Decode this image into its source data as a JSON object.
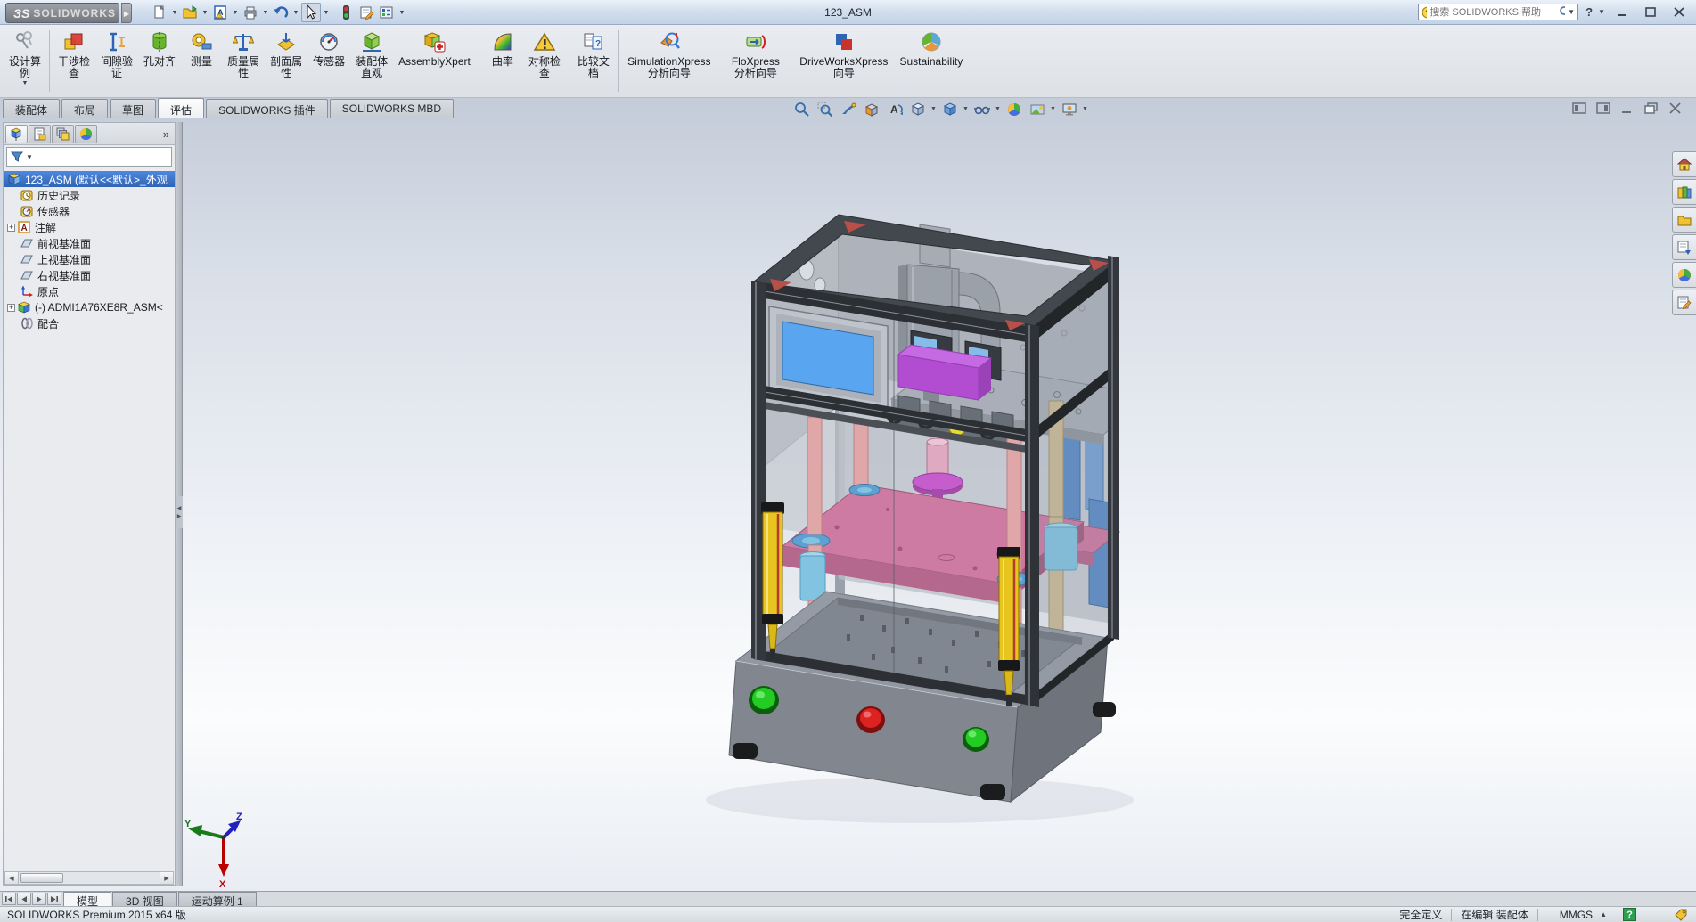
{
  "titlebar": {
    "brand_glyph": "ЗS",
    "brand_name": "SOLIDWORKS",
    "title": "123_ASM",
    "search": {
      "placeholder": "搜索 SOLIDWORKS 帮助"
    }
  },
  "ribbon": {
    "buttons": [
      {
        "id": "design-study",
        "label": "设计算\n例"
      },
      {
        "id": "interference-check",
        "label": "干涉检\n查"
      },
      {
        "id": "clearance-verify",
        "label": "间隙验\n证"
      },
      {
        "id": "hole-alignment",
        "label": "孔对齐"
      },
      {
        "id": "measure",
        "label": "测量"
      },
      {
        "id": "mass-properties",
        "label": "质量属\n性"
      },
      {
        "id": "section-properties",
        "label": "剖面属\n性"
      },
      {
        "id": "sensors",
        "label": "传感器"
      },
      {
        "id": "assembly-visualization",
        "label": "装配体\n直观"
      },
      {
        "id": "assemblyxpert",
        "label": "AssemblyXpert"
      },
      {
        "id": "curvature",
        "label": "曲率"
      },
      {
        "id": "symmetry-check",
        "label": "对称检\n查"
      },
      {
        "id": "compare-documents",
        "label": "比较文\n档"
      },
      {
        "id": "simulationxpress",
        "label": "SimulationXpress\n分析向导"
      },
      {
        "id": "floxpress",
        "label": "FloXpress\n分析向导"
      },
      {
        "id": "driveworksxpress",
        "label": "DriveWorksXpress\n向导"
      },
      {
        "id": "sustainability",
        "label": "Sustainability"
      }
    ]
  },
  "command_tabs": [
    {
      "label": "装配体"
    },
    {
      "label": "布局"
    },
    {
      "label": "草图"
    },
    {
      "label": "评估",
      "active": true
    },
    {
      "label": "SOLIDWORKS 插件"
    },
    {
      "label": "SOLIDWORKS MBD"
    }
  ],
  "feature_tree": {
    "root": "123_ASM (默认<<默认>_外观",
    "items": [
      {
        "label": "历史记录"
      },
      {
        "label": "传感器"
      },
      {
        "label": "注解",
        "expandable": true
      },
      {
        "label": "前视基准面"
      },
      {
        "label": "上视基准面"
      },
      {
        "label": "右视基准面"
      },
      {
        "label": "原点"
      },
      {
        "label": "(-) ADMI1A76XE8R_ASM<",
        "expandable": true
      },
      {
        "label": "配合"
      }
    ]
  },
  "triad": {
    "x": "X",
    "y": "Y",
    "z": "Z"
  },
  "bottom_tabs": [
    {
      "label": "模型",
      "active": true
    },
    {
      "label": "3D 视图"
    },
    {
      "label": "运动算例 1"
    }
  ],
  "status_bar": {
    "product": "SOLIDWORKS Premium 2015 x64 版",
    "defined_state": "完全定义",
    "editing_state": "在编辑 装配体",
    "units": "MMGS"
  },
  "icons": {
    "search": "magnifier",
    "help": "question-balloon",
    "rebuild": "traffic-light",
    "filter": "funnel",
    "mates": "paperclips",
    "origin": "axes",
    "plane": "parallelogram"
  },
  "colors": {
    "selection_blue": "#2f64b5",
    "hmi_screen_blue": "#4da3f7",
    "press_plate_pink": "#d4729e",
    "manifold_purple": "#b43cd4",
    "light_curtain_yellow": "#e8c41e",
    "button_green": "#22cc22",
    "button_red": "#dd2222"
  }
}
